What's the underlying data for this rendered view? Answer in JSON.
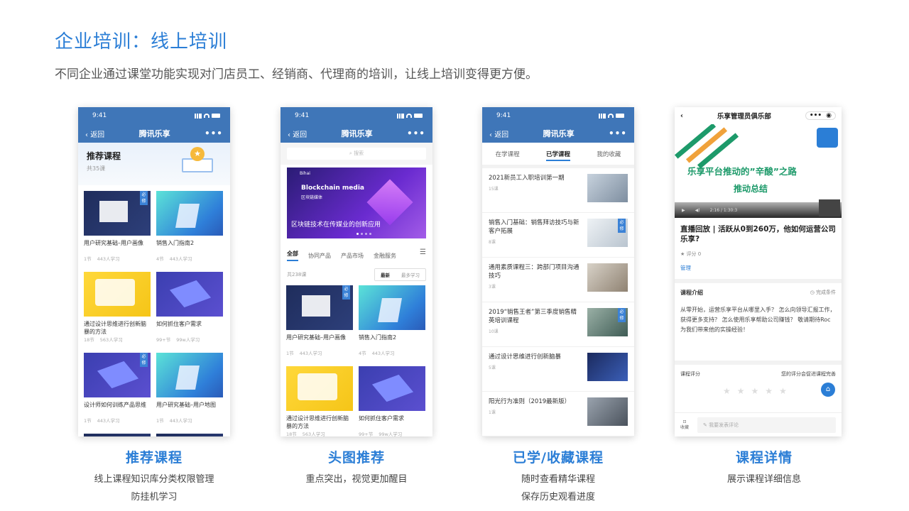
{
  "header": {
    "title": "企业培训：线上培训",
    "subtitle": "不同企业通过课堂功能实现对门店员工、经销商、代理商的培训，让线上培训变得更方便。"
  },
  "status": {
    "time": "9:41"
  },
  "nav": {
    "back": "返回",
    "title": "腾讯乐享",
    "more": "•••"
  },
  "phone1": {
    "section_title": "推荐课程",
    "section_count": "共35课",
    "cards": [
      {
        "title": "用户研究基础–用户画像",
        "lessons": "1节",
        "learners": "443人学习",
        "tag": "必修"
      },
      {
        "title": "销售入门指南2",
        "lessons": "4节",
        "learners": "443人学习"
      },
      {
        "title": "通过设计思维进行创新脑暴的方法",
        "lessons": "18节",
        "learners": "563人学习"
      },
      {
        "title": "如何抓住客户需求",
        "lessons": "99+节",
        "learners": "99w人学习"
      },
      {
        "title": "设计师如何训练产品思维",
        "lessons": "1节",
        "learners": "443人学习",
        "tag": "必修"
      },
      {
        "title": "用户研究基础–用户地图",
        "lessons": "1节",
        "learners": "443人学习"
      }
    ]
  },
  "phone2": {
    "search_placeholder": "搜索",
    "banner": {
      "brand": "Bihai",
      "title_en": "Blockchain media",
      "title_cn": "区块链媒体",
      "caption": "区块链技术在传媒业的创新应用"
    },
    "tabs": [
      "全部",
      "协同产品",
      "产品市场",
      "金融服务"
    ],
    "count": "共238课",
    "sort": [
      "最新",
      "最多学习"
    ],
    "cards": [
      {
        "title": "用户研究基础–用户画像",
        "lessons": "1节",
        "learners": "443人学习",
        "tag": "必修"
      },
      {
        "title": "销售入门指南2",
        "lessons": "4节",
        "learners": "443人学习"
      },
      {
        "title": "通过设计思维进行创新脑暴的方法",
        "lessons": "18节",
        "learners": "563人学习"
      },
      {
        "title": "如何抓住客户需求",
        "lessons": "99+节",
        "learners": "99w人学习"
      }
    ]
  },
  "phone3": {
    "tabs": [
      "在学课程",
      "已学课程",
      "我的收藏"
    ],
    "items": [
      {
        "title": "2021新员工入职培训第一期",
        "meta": "15课"
      },
      {
        "title": "销售入门基础：销售拜访技巧与新客户拓展",
        "meta": "8课",
        "tag": "必修"
      },
      {
        "title": "通用素质课程三：跨部门项目沟通技巧",
        "meta": "3课"
      },
      {
        "title": "2019“销售王者”第三季度销售精英培训课程",
        "meta": "10课",
        "tag": "必修"
      },
      {
        "title": "通过设计思维进行创新脑暴",
        "meta": "5课"
      },
      {
        "title": "阳光行为准则（2019最新版）",
        "meta": "1课"
      }
    ]
  },
  "phone4": {
    "nav_title": "乐享管理员俱乐部",
    "video": {
      "line1": "乐享平台推动的”辛酸”之路",
      "line2": "推动总结",
      "time": "2:16 / 1:30:3"
    },
    "title": "直播回放 | 活跃从0到260万，他如何运营公司乐享?",
    "score": "评分 0",
    "manage": "管理",
    "intro_label": "课程介绍",
    "complete_label": "完成条件",
    "intro": "从零开始，运营乐享平台从哪里入手？ 怎么向领导汇报工作，获得更多支持？ 怎么使用乐享帮助公司赚钱？ 敬请期待Roc为我们带来他的实操经验！",
    "rating_label": "课程评分",
    "rating_hint": "您的评分会促进课程完善",
    "fav": "收藏",
    "comment_placeholder": "我要发表评论"
  },
  "captions": [
    {
      "title": "推荐课程",
      "lines": [
        "线上课程知识库分类权限管理",
        "防挂机学习"
      ]
    },
    {
      "title": "头图推荐",
      "lines": [
        "重点突出，视觉更加醒目"
      ]
    },
    {
      "title": "已学/收藏课程",
      "lines": [
        "随时查看精华课程",
        "保存历史观看进度"
      ]
    },
    {
      "title": "课程详情",
      "lines": [
        "展示课程详细信息"
      ]
    }
  ],
  "colors": {
    "accent": "#2b7ed6",
    "navbar": "#3f76b8",
    "green_text": "#1d9a6a"
  }
}
